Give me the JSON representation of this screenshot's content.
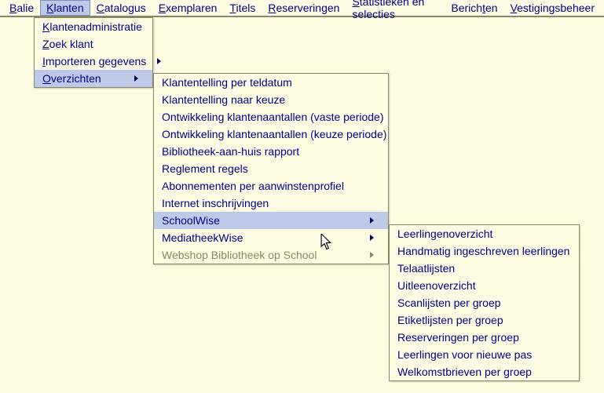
{
  "menubar": {
    "items": [
      {
        "label": "Balie",
        "u": 0
      },
      {
        "label": "Klanten",
        "u": 0
      },
      {
        "label": "Catalogus",
        "u": 0
      },
      {
        "label": "Exemplaren",
        "u": 0
      },
      {
        "label": "Titels",
        "u": 0
      },
      {
        "label": "Reserveringen",
        "u": 0
      },
      {
        "label": "Statistieken en selecties",
        "u": 0
      },
      {
        "label": "Berichten",
        "u": 6
      },
      {
        "label": "Vestigingsbeheer",
        "u": 0
      }
    ]
  },
  "menu1": {
    "items": [
      {
        "label": "Klantenadministratie",
        "u": 0
      },
      {
        "label": "Zoek klant",
        "u": 0
      },
      {
        "label": "Importeren gegevens",
        "u": 0,
        "arrow": true
      },
      {
        "label": "Overzichten",
        "u": 0,
        "arrow": true,
        "highlight": true
      }
    ]
  },
  "menu2": {
    "items": [
      {
        "label": "Klantentelling per teldatum"
      },
      {
        "label": "Klantentelling naar keuze"
      },
      {
        "label": "Ontwikkeling klantenaantallen (vaste periode)"
      },
      {
        "label": "Ontwikkeling klantenaantallen (keuze periode)"
      },
      {
        "label": "Bibliotheek-aan-huis rapport"
      },
      {
        "label": "Reglement regels"
      },
      {
        "label": "Abonnementen per aanwinstenprofiel"
      },
      {
        "label": "Internet inschrijvingen"
      },
      {
        "label": "SchoolWise",
        "arrow": true,
        "highlight": true
      },
      {
        "label": "MediatheekWise",
        "arrow": true
      },
      {
        "label": "Webshop Bibliotheek op School",
        "arrow": true,
        "disabled": true
      }
    ]
  },
  "menu3": {
    "items": [
      {
        "label": "Leerlingenoverzicht"
      },
      {
        "label": "Handmatig ingeschreven leerlingen"
      },
      {
        "label": "Telaatlijsten"
      },
      {
        "label": "Uitleenoverzicht"
      },
      {
        "label": "Scanlijsten per groep"
      },
      {
        "label": "Etiketlijsten per groep"
      },
      {
        "label": "Reserveringen per groep"
      },
      {
        "label": "Leerlingen voor nieuwe pas"
      },
      {
        "label": "Welkomstbrieven per groep"
      }
    ]
  }
}
